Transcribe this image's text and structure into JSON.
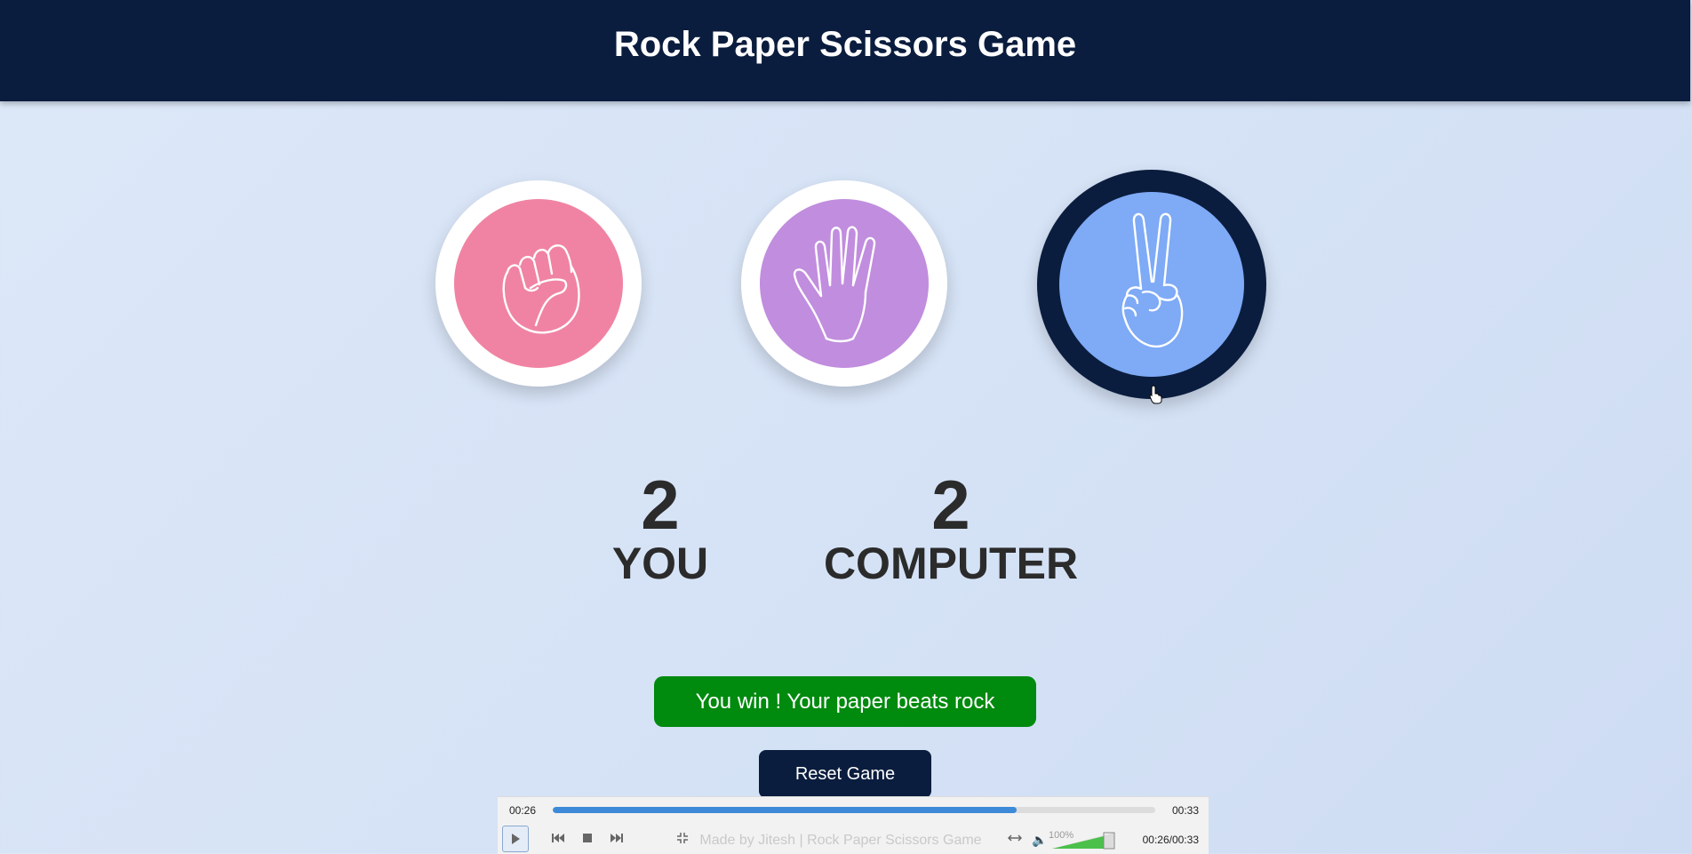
{
  "header": {
    "title": "Rock Paper Scissors Game"
  },
  "choices": [
    {
      "id": "rock",
      "color": "#f083a3",
      "icon": "rock-fist-icon"
    },
    {
      "id": "paper",
      "color": "#c18dde",
      "icon": "paper-hand-icon"
    },
    {
      "id": "scissors",
      "color": "#7eaaf6",
      "icon": "scissors-hand-icon",
      "selected": true
    }
  ],
  "score": {
    "user": {
      "value": "2",
      "label": "YOU"
    },
    "computer": {
      "value": "2",
      "label": "COMPUTER"
    }
  },
  "message": {
    "text": "You win ! Your paper beats rock",
    "color": "#008a0e"
  },
  "reset_button": {
    "label": "Reset Game"
  },
  "player": {
    "current_time": "00:26",
    "total_time": "00:33",
    "time_readout": "00:26/00:33",
    "progress": 0.77,
    "volume_label": "100%",
    "footer_text": "Made by Jitesh | Rock Paper Scissors Game"
  },
  "colors": {
    "header_bg": "#0b1d3e",
    "accent": "#3d8ad8"
  }
}
